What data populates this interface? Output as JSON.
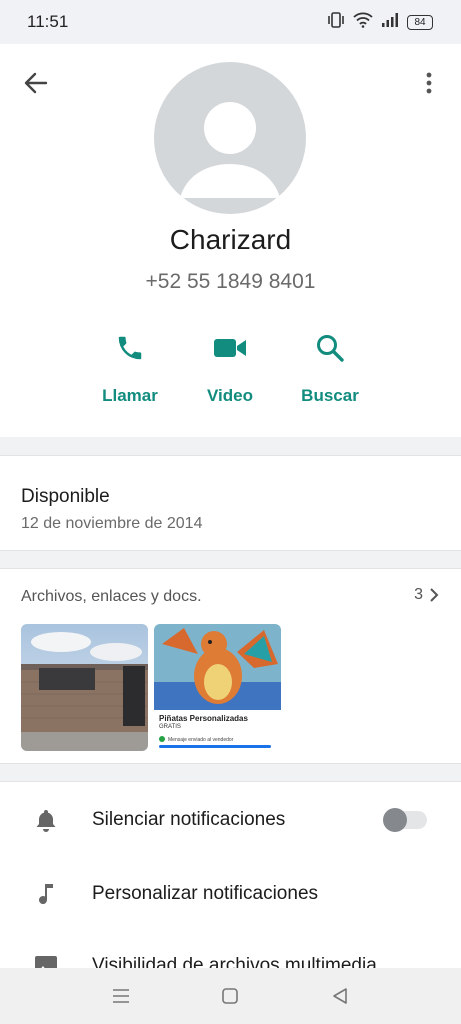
{
  "status_bar": {
    "time": "11:51",
    "battery": "84"
  },
  "contact": {
    "name": "Charizard",
    "phone": "+52 55 1849 8401"
  },
  "actions": [
    {
      "label": "Llamar",
      "icon": "phone-icon"
    },
    {
      "label": "Video",
      "icon": "video-icon"
    },
    {
      "label": "Buscar",
      "icon": "search-icon"
    }
  ],
  "about": {
    "text": "Disponible",
    "date": "12 de noviembre de 2014"
  },
  "media": {
    "title": "Archivos, enlaces y docs.",
    "count": "3",
    "thumb2": {
      "title": "Piñatas Personalizadas",
      "subtitle": "GRATIS",
      "message": "Mensaje enviado al vendedor"
    }
  },
  "settings": [
    {
      "label": "Silenciar notificaciones",
      "icon": "bell-icon",
      "toggle": false
    },
    {
      "label": "Personalizar notificaciones",
      "icon": "music-note-icon"
    },
    {
      "label": "Visibilidad de archivos multimedia",
      "icon": "image-icon"
    }
  ],
  "colors": {
    "accent": "#128c7e",
    "avatar_bg": "#d3d7da"
  }
}
